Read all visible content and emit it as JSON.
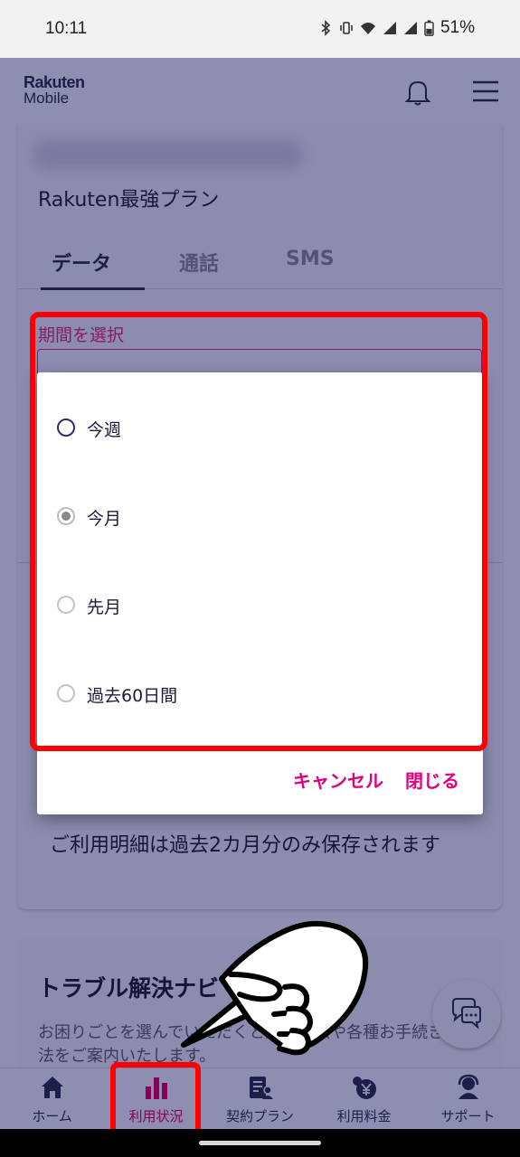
{
  "status_bar": {
    "time": "10:11",
    "battery": "51%"
  },
  "header": {
    "logo_line1": "Rakuten",
    "logo_line2": "Mobile"
  },
  "usage_card": {
    "plan_name": "Rakuten最強プラン",
    "tabs": [
      {
        "label": "データ",
        "active": true
      },
      {
        "label": "通話",
        "active": false
      },
      {
        "label": "SMS",
        "active": false
      }
    ],
    "period_label": "期間を選択",
    "storage_note": "ご利用明細は過去2カ月分のみ保存されます"
  },
  "period_dialog": {
    "options": [
      {
        "label": "今週",
        "checked": false
      },
      {
        "label": "今月",
        "checked": true
      },
      {
        "label": "先月",
        "checked": false
      },
      {
        "label": "過去60日間",
        "checked": false
      }
    ],
    "cancel_label": "キャンセル",
    "close_label": "閉じる"
  },
  "nav_card": {
    "title": "トラブル解決ナビ",
    "description": "お困りごとを選んでいただくと解決方法や各種お手続き方法をご案内いたします。"
  },
  "bottom_nav": {
    "items": [
      {
        "label": "ホーム",
        "icon": "home-icon",
        "active": false
      },
      {
        "label": "利用状況",
        "icon": "bar-chart-icon",
        "active": true
      },
      {
        "label": "契約プラン",
        "icon": "contract-icon",
        "active": false
      },
      {
        "label": "利用料金",
        "icon": "yen-icon",
        "active": false
      },
      {
        "label": "サポート",
        "icon": "support-icon",
        "active": false
      }
    ]
  },
  "colors": {
    "accent": "#e0007e",
    "brand_dark": "#1c1f4a",
    "highlight": "#ff0000"
  }
}
